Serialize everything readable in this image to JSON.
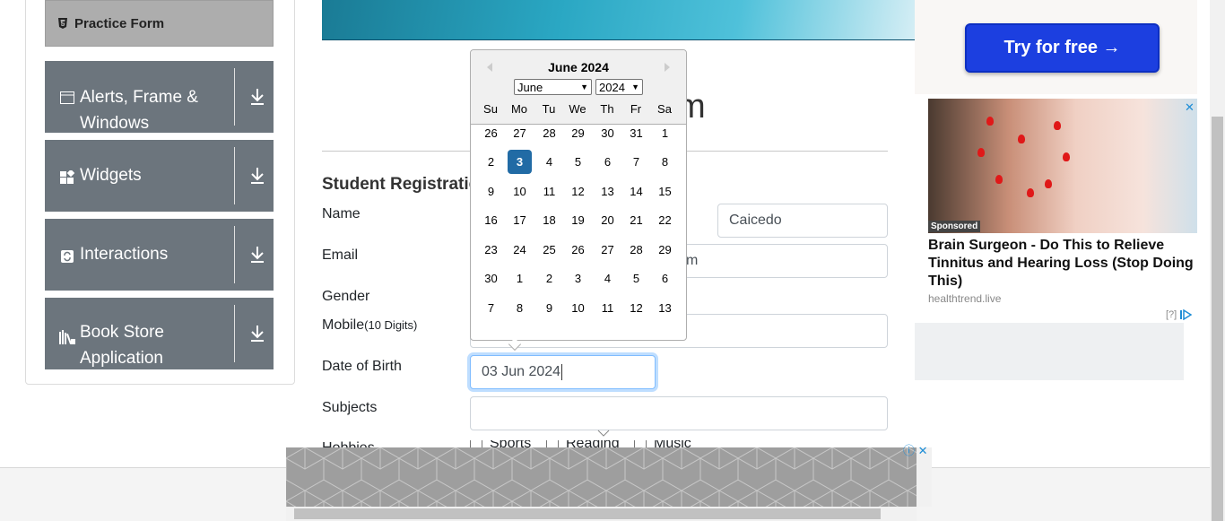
{
  "sidebar": {
    "practice_form": "Practice Form",
    "groups": [
      {
        "label": "Alerts, Frame & Windows",
        "icon": "window-icon"
      },
      {
        "label": "Widgets",
        "icon": "widgets-icon"
      },
      {
        "label": "Interactions",
        "icon": "interactions-icon"
      },
      {
        "label": "Book Store Application",
        "icon": "book-store-icon"
      }
    ]
  },
  "main": {
    "ghost_title": "m",
    "section_title": "Student Registration Form",
    "labels": {
      "name": "Name",
      "email": "Email",
      "gender": "Gender",
      "mobile": "Mobile",
      "mobile_hint": "(10 Digits)",
      "dob": "Date of Birth",
      "subjects": "Subjects",
      "hobbies": "Hobbies"
    },
    "last_name_value": "Caicedo",
    "email_value_tail": "m",
    "dob_value": "03 Jun 2024",
    "hobbies": [
      "Sports",
      "Reading",
      "Music"
    ]
  },
  "datepicker": {
    "title": "June 2024",
    "month_selected": "June",
    "year_selected": "2024",
    "weekdays": [
      "Su",
      "Mo",
      "Tu",
      "We",
      "Th",
      "Fr",
      "Sa"
    ],
    "weeks": [
      [
        "26",
        "27",
        "28",
        "29",
        "30",
        "31",
        "1"
      ],
      [
        "2",
        "3",
        "4",
        "5",
        "6",
        "7",
        "8"
      ],
      [
        "9",
        "10",
        "11",
        "12",
        "13",
        "14",
        "15"
      ],
      [
        "16",
        "17",
        "18",
        "19",
        "20",
        "21",
        "22"
      ],
      [
        "23",
        "24",
        "25",
        "26",
        "27",
        "28",
        "29"
      ],
      [
        "30",
        "1",
        "2",
        "3",
        "4",
        "5",
        "6"
      ],
      [
        "7",
        "8",
        "9",
        "10",
        "11",
        "12",
        "13"
      ]
    ],
    "selected_day": "3"
  },
  "ad": {
    "cta": "Try for free →",
    "sponsored": "Sponsored",
    "headline": "Brain Surgeon - Do This to Relieve Tinnitus and Hearing Loss (Stop Doing This)",
    "domain": "healthtrend.live",
    "choice": "[?]"
  }
}
